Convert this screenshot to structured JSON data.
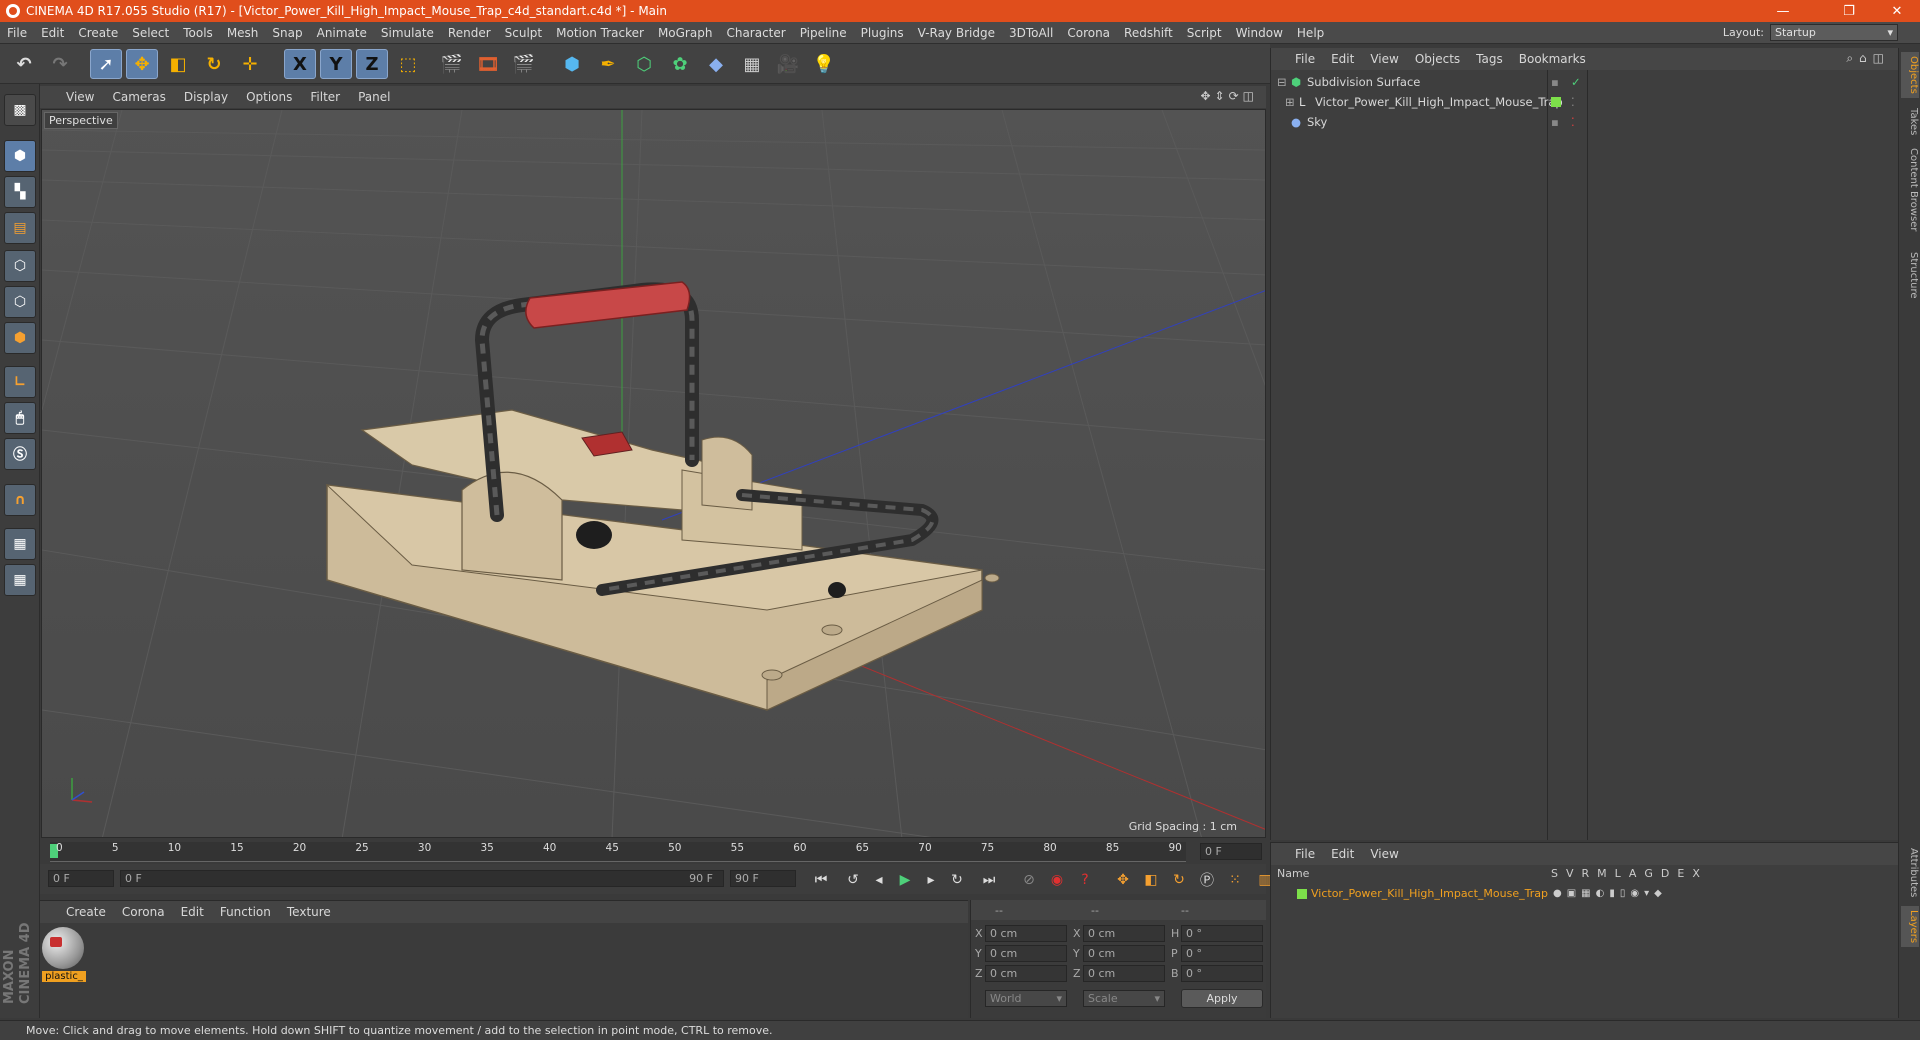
{
  "window": {
    "title": "CINEMA 4D R17.055 Studio (R17) - [Victor_Power_Kill_High_Impact_Mouse_Trap_c4d_standart.c4d *] - Main",
    "controls": [
      "—",
      "❐",
      "✕"
    ]
  },
  "menu": [
    "File",
    "Edit",
    "Create",
    "Select",
    "Tools",
    "Mesh",
    "Snap",
    "Animate",
    "Simulate",
    "Render",
    "Sculpt",
    "Motion Tracker",
    "MoGraph",
    "Character",
    "Pipeline",
    "Plugins",
    "V-Ray Bridge",
    "3DToAll",
    "Corona",
    "Redshift",
    "Script",
    "Window",
    "Help"
  ],
  "layout": {
    "label": "Layout:",
    "value": "Startup"
  },
  "toolbar": {
    "axis_x": "X",
    "axis_y": "Y",
    "axis_z": "Z"
  },
  "viewport": {
    "menu": [
      "View",
      "Cameras",
      "Display",
      "Options",
      "Filter",
      "Panel"
    ],
    "camera_label": "Perspective",
    "grid_spacing": "Grid Spacing : 1 cm"
  },
  "timeline": {
    "ticks": [
      "0",
      "5",
      "10",
      "15",
      "20",
      "25",
      "30",
      "35",
      "40",
      "45",
      "50",
      "55",
      "60",
      "65",
      "70",
      "75",
      "80",
      "85",
      "90"
    ],
    "current_frame": "0 F",
    "start_field": "0 F",
    "range_start": "0 F",
    "range_end": "90 F",
    "end_field": "90 F"
  },
  "material_manager": {
    "menu": [
      "Create",
      "Corona",
      "Edit",
      "Function",
      "Texture"
    ],
    "materials": [
      {
        "name": "plastic_"
      }
    ]
  },
  "brand": {
    "line1": "MAXON",
    "line2": "CINEMA 4D"
  },
  "coordinates": {
    "header": [
      "--",
      "--",
      "--"
    ],
    "rows": [
      {
        "a": "X",
        "av": "0 cm",
        "b": "X",
        "bv": "0 cm",
        "c": "H",
        "cv": "0 °"
      },
      {
        "a": "Y",
        "av": "0 cm",
        "b": "Y",
        "bv": "0 cm",
        "c": "P",
        "cv": "0 °"
      },
      {
        "a": "Z",
        "av": "0 cm",
        "b": "Z",
        "bv": "0 cm",
        "c": "B",
        "cv": "0 °"
      }
    ],
    "space": "World",
    "mode": "Scale",
    "apply": "Apply"
  },
  "object_manager": {
    "menu": [
      "File",
      "Edit",
      "View",
      "Objects",
      "Tags",
      "Bookmarks"
    ],
    "objects": [
      {
        "name": "Subdivision Surface"
      },
      {
        "name": "Victor_Power_Kill_High_Impact_Mouse_Trap"
      },
      {
        "name": "Sky"
      }
    ]
  },
  "layer_manager": {
    "menu": [
      "File",
      "Edit",
      "View"
    ],
    "name_header": "Name",
    "columns": [
      "S",
      "V",
      "R",
      "M",
      "L",
      "A",
      "G",
      "D",
      "E",
      "X"
    ],
    "layers": [
      {
        "name": "Victor_Power_Kill_High_Impact_Mouse_Trap"
      }
    ]
  },
  "side_tabs": [
    "Objects",
    "Takes",
    "Content Browser",
    "Structure"
  ],
  "side_tabs_lower": [
    "Attributes",
    "Layers"
  ],
  "status": "Move: Click and drag to move elements. Hold down SHIFT to quantize movement / add to the selection in point mode, CTRL to remove.",
  "colors": {
    "accent": "#e04e1c",
    "selection": "#5d7ea8",
    "layer_color": "#7de04a",
    "layer_text": "#f0a020"
  }
}
